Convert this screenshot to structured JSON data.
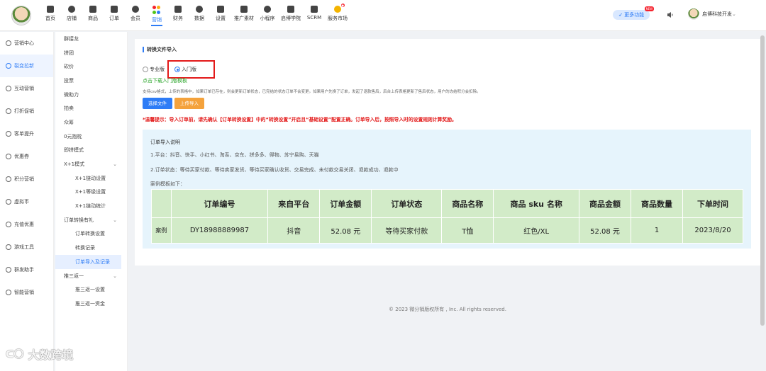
{
  "topnav": {
    "items": [
      {
        "label": "首页",
        "icon": "home-icon"
      },
      {
        "label": "店铺",
        "icon": "store-icon"
      },
      {
        "label": "商品",
        "icon": "goods-icon"
      },
      {
        "label": "订单",
        "icon": "order-icon"
      },
      {
        "label": "会员",
        "icon": "member-icon"
      },
      {
        "label": "营销",
        "icon": "marketing-icon"
      },
      {
        "label": "财务",
        "icon": "finance-icon"
      },
      {
        "label": "数据",
        "icon": "data-icon"
      },
      {
        "label": "设置",
        "icon": "settings-icon"
      },
      {
        "label": "推广素材",
        "icon": "share-icon"
      },
      {
        "label": "小程序",
        "icon": "miniapp-icon"
      },
      {
        "label": "启博学院",
        "icon": "academy-icon"
      },
      {
        "label": "SCRM",
        "icon": "scrm-icon"
      },
      {
        "label": "服务市场",
        "icon": "market-icon"
      }
    ],
    "active_index": 5,
    "more_label": "更多功能",
    "more_badge": "NEW",
    "user_name": "启博科技开发",
    "accent": "#2e7cf6"
  },
  "side1": {
    "items": [
      "营销中心",
      "裂变拉新",
      "互动营销",
      "打折促销",
      "客单提升",
      "优惠券",
      "积分营销",
      "虚拟币",
      "充值优惠",
      "游戏工具",
      "群发助手",
      "智能营销"
    ],
    "active_index": 1
  },
  "side2": {
    "items": [
      {
        "label": "群接龙",
        "sub": false
      },
      {
        "label": "拼团",
        "sub": false
      },
      {
        "label": "砍价",
        "sub": false
      },
      {
        "label": "投票",
        "sub": false
      },
      {
        "label": "微助力",
        "sub": false
      },
      {
        "label": "拍卖",
        "sub": false
      },
      {
        "label": "众筹",
        "sub": false
      },
      {
        "label": "0元抱枕",
        "sub": false
      },
      {
        "label": "即拼模式",
        "sub": false
      },
      {
        "label": "X+1模式",
        "sub": false,
        "caret": "⌄"
      },
      {
        "label": "X+1链动设置",
        "sub": true
      },
      {
        "label": "X+1等级设置",
        "sub": true
      },
      {
        "label": "X+1链动统计",
        "sub": true
      },
      {
        "label": "订单转换有礼",
        "sub": false,
        "caret": "⌄"
      },
      {
        "label": "订单转换设置",
        "sub": true
      },
      {
        "label": "转换记录",
        "sub": true
      },
      {
        "label": "订单导入及记录",
        "sub": true,
        "active": true
      },
      {
        "label": "推三返一",
        "sub": false,
        "caret": "⌄"
      },
      {
        "label": "推三返一设置",
        "sub": true
      },
      {
        "label": "推三返一资金",
        "sub": true
      }
    ]
  },
  "main": {
    "section_title": "转换文件导入",
    "radio_pro": "专业版",
    "radio_basic": "入门版",
    "download_link": "点击下载入门版模板",
    "hint": "支持csv格式，上传的表格中，如果订单已存在，则会更新订单状态，已完结的状态订单不会变更。如果用户先换了订单，发起了退款售后，后台上传表格更新了售后状态，用户的冻结积分会扣除。",
    "btn_select": "选择文件",
    "btn_upload": "上传导入",
    "warning": "*温馨提示：导入订单前，请先确认【订单转换设置】中的“转换设置”开启且“基础设置”配置正确。订单导入后，按照导入时的设置规则计算奖励。",
    "info_title": "订单导入说明",
    "info_line1": "1.平台：抖音、快手、小红书、淘系、京东、拼多多、得物、苏宁易购、天猫",
    "info_line2": "2.订单状态：等待买家付款、等待卖家发货、等待买家确认收货、交易完成、未付款交易关闭、退款成功、退款中",
    "info_line3": "案例模板如下：",
    "table": {
      "headers": [
        "",
        "订单编号",
        "来自平台",
        "订单金额",
        "订单状态",
        "商品名称",
        "商品 sku 名称",
        "商品金额",
        "商品数量",
        "下单时间"
      ],
      "row": [
        "案例",
        "DY18988889987",
        "抖音",
        "52.08 元",
        "等待买家付款",
        "T恤",
        "红色/XL",
        "52.08 元",
        "1",
        "2023/8/20"
      ]
    }
  },
  "footer": "© 2023 微分销版权所有 , Inc. All rights reserved.",
  "watermark": "大数跨境"
}
